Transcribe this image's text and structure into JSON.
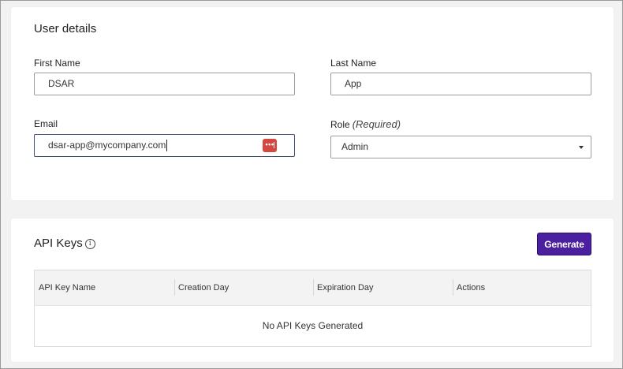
{
  "user_details": {
    "title": "User details",
    "first_name": {
      "label": "First Name",
      "value": "DSAR"
    },
    "last_name": {
      "label": "Last Name",
      "value": "App"
    },
    "email": {
      "label": "Email",
      "value": "dsar-app@mycompany.com",
      "password_manager_icon": "password-manager-icon"
    },
    "role": {
      "label": "Role",
      "required_note": "(Required)",
      "selected": "Admin"
    }
  },
  "api_keys": {
    "title": "API Keys",
    "info_icon": "info-icon",
    "generate_label": "Generate",
    "columns": [
      "API Key Name",
      "Creation Day",
      "Expiration Day",
      "Actions"
    ],
    "empty_message": "No API Keys Generated"
  },
  "colors": {
    "accent": "#4a1fa0",
    "password_icon": "#d4483f",
    "focused_border": "#3f5170"
  }
}
